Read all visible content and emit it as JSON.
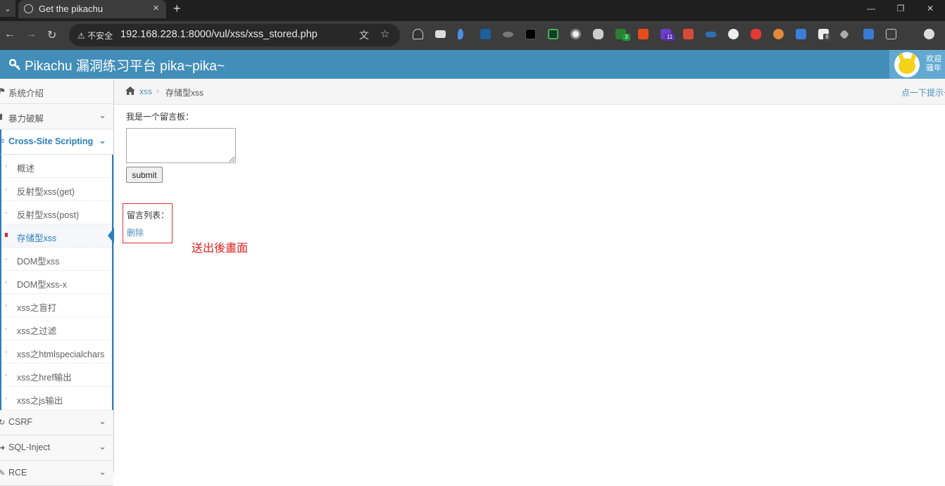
{
  "browser": {
    "tab_title": "Get the pikachu",
    "url": "192.168.228.1:8000/vul/xss/xss_stored.php",
    "security_label": "不安全",
    "ext_badges": [
      "3",
      "11",
      "8"
    ]
  },
  "header": {
    "brand": "Pikachu 漏洞练习平台 pika~pika~",
    "welcome_line1": "欢迎",
    "welcome_line2": "骚年"
  },
  "sidebar": {
    "top_items": [
      {
        "label": "系统介绍",
        "icon": "desktop-icon"
      },
      {
        "label": "暴力破解",
        "icon": "lock-icon"
      }
    ],
    "open_section": {
      "label": "Cross-Site Scripting",
      "icon": "list-icon"
    },
    "sub_items": [
      "概述",
      "反射型xss(get)",
      "反射型xss(post)",
      "存储型xss",
      "DOM型xss",
      "DOM型xss-x",
      "xss之盲打",
      "xss之过滤",
      "xss之htmlspecialchars",
      "xss之href输出",
      "xss之js输出"
    ],
    "active_index": 3,
    "bottom_items": [
      {
        "label": "CSRF",
        "icon": "refresh-icon"
      },
      {
        "label": "SQL-Inject",
        "icon": "arrow-right-icon"
      },
      {
        "label": "RCE",
        "icon": "pencil-icon"
      }
    ]
  },
  "breadcrumb": {
    "link": "xss",
    "current": "存储型xss",
    "hint": "点一下提示~"
  },
  "main": {
    "board_label": "我是一个留言板：",
    "message_value": "",
    "submit_label": "submit",
    "list_label": "留言列表：",
    "delete_label": "删除",
    "annotation": "送出後畫面"
  },
  "colors": {
    "header": "#438eb9",
    "accent": "#2b7dbc",
    "annotation": "#e02020"
  }
}
